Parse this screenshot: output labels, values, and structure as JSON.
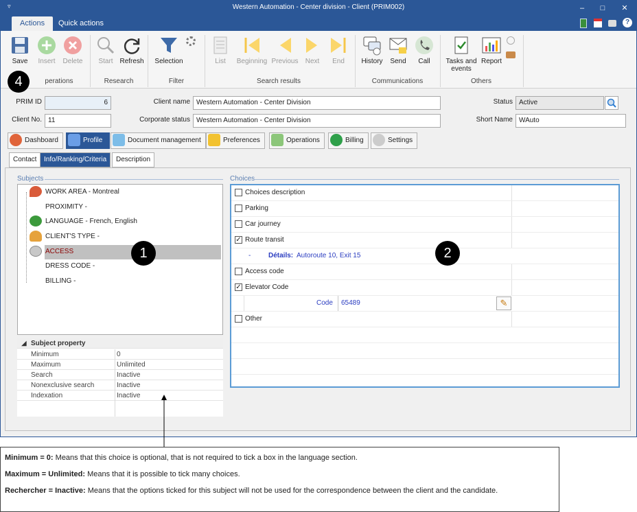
{
  "window": {
    "title": "Western Automation - Center division - Client (PRIM002)",
    "min": "–",
    "max": "□",
    "close": "✕"
  },
  "ribbon_tabs": [
    "Actions",
    "Quick actions"
  ],
  "ribbon": {
    "buttons": [
      {
        "label": "Save",
        "icon": "save-icon"
      },
      {
        "label": "Insert",
        "icon": "insert-icon"
      },
      {
        "label": "Delete",
        "icon": "delete-icon"
      },
      {
        "label": "Start",
        "icon": "search-start-icon"
      },
      {
        "label": "Refresh",
        "icon": "refresh-icon"
      },
      {
        "label": "Selection",
        "icon": "filter-icon"
      },
      {
        "label": "List",
        "icon": "list-icon"
      },
      {
        "label": "Beginning",
        "icon": "first-icon"
      },
      {
        "label": "Previous",
        "icon": "previous-icon"
      },
      {
        "label": "Next",
        "icon": "next-icon"
      },
      {
        "label": "End",
        "icon": "last-icon"
      },
      {
        "label": "History",
        "icon": "history-icon"
      },
      {
        "label": "Send",
        "icon": "send-icon"
      },
      {
        "label": "Call",
        "icon": "call-icon"
      },
      {
        "label": "Tasks and events",
        "icon": "tasks-icon"
      },
      {
        "label": "Report",
        "icon": "report-icon"
      }
    ],
    "groups": [
      "Operations",
      "Research",
      "Filter",
      "Search results",
      "Communications",
      "Others"
    ],
    "visible_group_text": "perations"
  },
  "markers": {
    "m1": "1",
    "m2": "2",
    "m4": "4"
  },
  "header": {
    "prim_id_label": "PRIM ID",
    "prim_id_value": "6",
    "client_no_label": "Client No.",
    "client_no_value": "11",
    "client_name_label": "Client name",
    "client_name_value": "Western Automation - Center Division",
    "corporate_status_label": "Corporate status",
    "corporate_status_value": "Western Automation - Center Division",
    "status_label": "Status",
    "status_value": "Active",
    "short_name_label": "Short Name",
    "short_name_value": "WAuto"
  },
  "main_tabs": [
    "Dashboard",
    "Profile",
    "Document management",
    "Preferences",
    "Operations",
    "Billing",
    "Settings"
  ],
  "sub_tabs": [
    "Contact",
    "Info/Ranking/Criteria",
    "Description"
  ],
  "subjects": {
    "legend": "Subjects",
    "items": [
      "WORK AREA - Montreal",
      "PROXIMITY -",
      "LANGUAGE - French, English",
      "CLIENT'S TYPE -",
      "ACCESS",
      "DRESS CODE -",
      "BILLING -"
    ]
  },
  "properties": {
    "title": "Subject property",
    "rows": [
      {
        "k": "Minimum",
        "v": "0"
      },
      {
        "k": "Maximum",
        "v": "Unlimited"
      },
      {
        "k": "Search",
        "v": "Inactive"
      },
      {
        "k": "Nonexclusive search",
        "v": "Inactive"
      },
      {
        "k": "Indexation",
        "v": "Inactive"
      }
    ]
  },
  "choices": {
    "legend": "Choices",
    "items": [
      {
        "label": "Choices description",
        "checked": false
      },
      {
        "label": "Parking",
        "checked": false
      },
      {
        "label": "Car journey",
        "checked": false
      },
      {
        "label": "Route transit",
        "checked": true
      },
      {
        "label": "Access code",
        "checked": false
      },
      {
        "label": "Elevator Code",
        "checked": true
      },
      {
        "label": "Other",
        "checked": false
      }
    ],
    "route_detail_dash": "-",
    "route_detail_label": "Détails:",
    "route_detail_value": "Autoroute 10, Exit 15",
    "elevator_code_label": "Code",
    "elevator_code_value": "65489"
  },
  "note": {
    "l1_bold": "Minimum = 0:",
    "l1": " Means that this choice is optional, that is not required to tick a box in the language section.",
    "l2_bold": "Maximum = Unlimited:",
    "l2": " Means that it is possible to tick many choices.",
    "l3_bold": "Rechercher = Inactive:",
    "l3": " Means that the options ticked for this subject will not be used for the correspondence between the client and the candidate."
  },
  "colors": {
    "accent": "#2b5797",
    "selection": "#c0c0c0",
    "access_text": "#8b0000"
  }
}
